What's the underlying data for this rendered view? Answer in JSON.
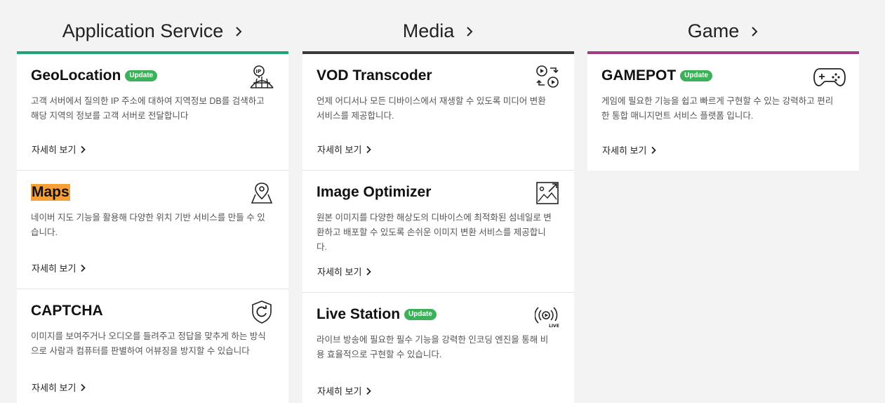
{
  "columns": {
    "app": {
      "title": "Application Service",
      "accent": "#1fa477",
      "cards": [
        {
          "title": "GeoLocation",
          "badge": "Update",
          "desc": "고객 서버에서 질의한 IP 주소에 대하여 지역정보 DB를 검색하고 해당 지역의 정보를 고객 서버로 전달합니다",
          "more": "자세히 보기",
          "icon": "globe-ip-icon"
        },
        {
          "title": "Maps",
          "desc": "네이버 지도 기능을 활용해 다양한 위치 기반 서비스를 만들 수 있습니다.",
          "more": "자세히 보기",
          "icon": "map-pin-icon"
        },
        {
          "title": "CAPTCHA",
          "desc": "이미지를 보여주거나 오디오를 들려주고 정답을 맞추게 하는 방식으로 사람과 컴퓨터를 판별하여 어뷰징을 방지할 수 있습니다",
          "more": "자세히 보기",
          "icon": "shield-refresh-icon"
        }
      ]
    },
    "media": {
      "title": "Media",
      "accent": "#3a3a3a",
      "cards": [
        {
          "title": "VOD Transcoder",
          "desc": "언제 어디서나 모든 디바이스에서 재생할 수 있도록 미디어 변환 서비스를 제공합니다.",
          "more": "자세히 보기",
          "icon": "transcode-icon"
        },
        {
          "title": "Image Optimizer",
          "desc": "원본 이미지를 다양한 해상도의 디바이스에 최적화된 섬네일로 변환하고 배포할 수 있도록 손쉬운 이미지 변환 서비스를 제공합니다.",
          "more": "자세히 보기",
          "icon": "image-resize-icon"
        },
        {
          "title": "Live Station",
          "badge": "Update",
          "desc": "라이브 방송에 필요한 필수 기능을 강력한 인코딩 엔진을 통해 비용 효율적으로 구현할 수 있습니다.",
          "more": "자세히 보기",
          "icon": "live-broadcast-icon"
        }
      ]
    },
    "game": {
      "title": "Game",
      "accent": "#a23c82",
      "cards": [
        {
          "title": "GAMEPOT",
          "badge": "Update",
          "desc": "게임에 필요한 기능을 쉽고 빠르게 구현할 수 있는 강력하고 편리한 통합 매니지먼트 서비스 플랫폼 입니다.",
          "more": "자세히 보기",
          "icon": "gamepad-icon"
        }
      ]
    }
  }
}
